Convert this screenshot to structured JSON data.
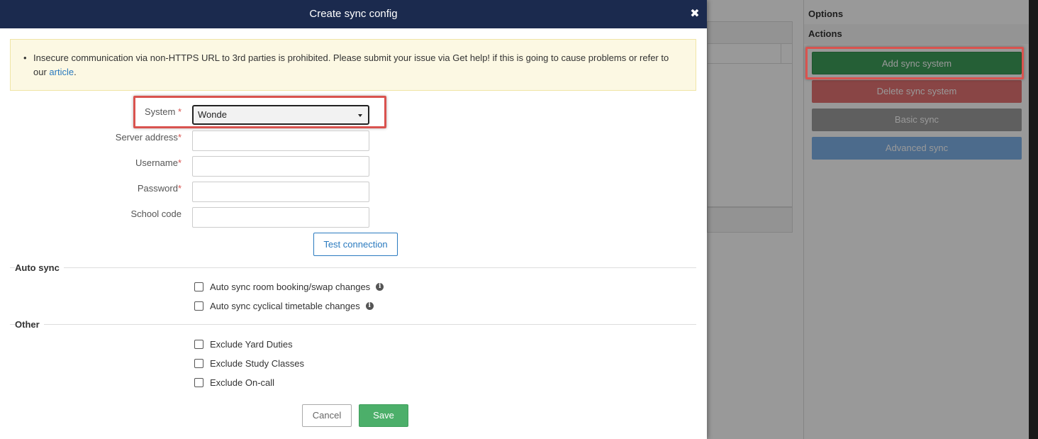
{
  "modal": {
    "title": "Create sync config",
    "close_icon": "close-icon",
    "alert": {
      "bullet": "•",
      "text": "Insecure communication via non-HTTPS URL to 3rd parties is prohibited. Please submit your issue via Get help! if this is going to cause problems or refer to our",
      "link_text": "article",
      "suffix": "."
    },
    "fields": {
      "system": {
        "label": "System",
        "required": "*",
        "value": "Wonde"
      },
      "server_address": {
        "label": "Server address",
        "required": "*",
        "value": ""
      },
      "username": {
        "label": "Username",
        "required": "*",
        "value": ""
      },
      "password": {
        "label": "Password",
        "required": "*",
        "value": ""
      },
      "school_code": {
        "label": "School code",
        "value": ""
      }
    },
    "test_connection_label": "Test connection",
    "auto_sync": {
      "title": "Auto sync",
      "options": [
        {
          "label": "Auto sync room booking/swap changes",
          "checked": false,
          "info_icon": "info-icon"
        },
        {
          "label": "Auto sync cyclical timetable changes",
          "checked": false,
          "info_icon": "info-icon"
        }
      ]
    },
    "other": {
      "title": "Other",
      "options": [
        {
          "label": "Exclude Yard Duties",
          "checked": false
        },
        {
          "label": "Exclude Study Classes",
          "checked": false
        },
        {
          "label": "Exclude On-call",
          "checked": false
        }
      ]
    },
    "cancel_label": "Cancel",
    "save_label": "Save"
  },
  "sidebar": {
    "options_title": "Options",
    "actions_title": "Actions",
    "buttons": {
      "add": "Add sync system",
      "delete": "Delete sync system",
      "basic": "Basic sync",
      "advanced": "Advanced sync"
    }
  },
  "colors": {
    "header_bg": "#1b2a4e",
    "alert_bg": "#fcf8e3",
    "save_green": "#4caf6a",
    "add_green": "#3e9f5b",
    "delete_red": "#e57373",
    "basic_gray": "#9e9e9e",
    "advanced_blue": "#7fb3ea",
    "link_blue": "#2a7abf",
    "highlight_red": "#d9534f"
  }
}
